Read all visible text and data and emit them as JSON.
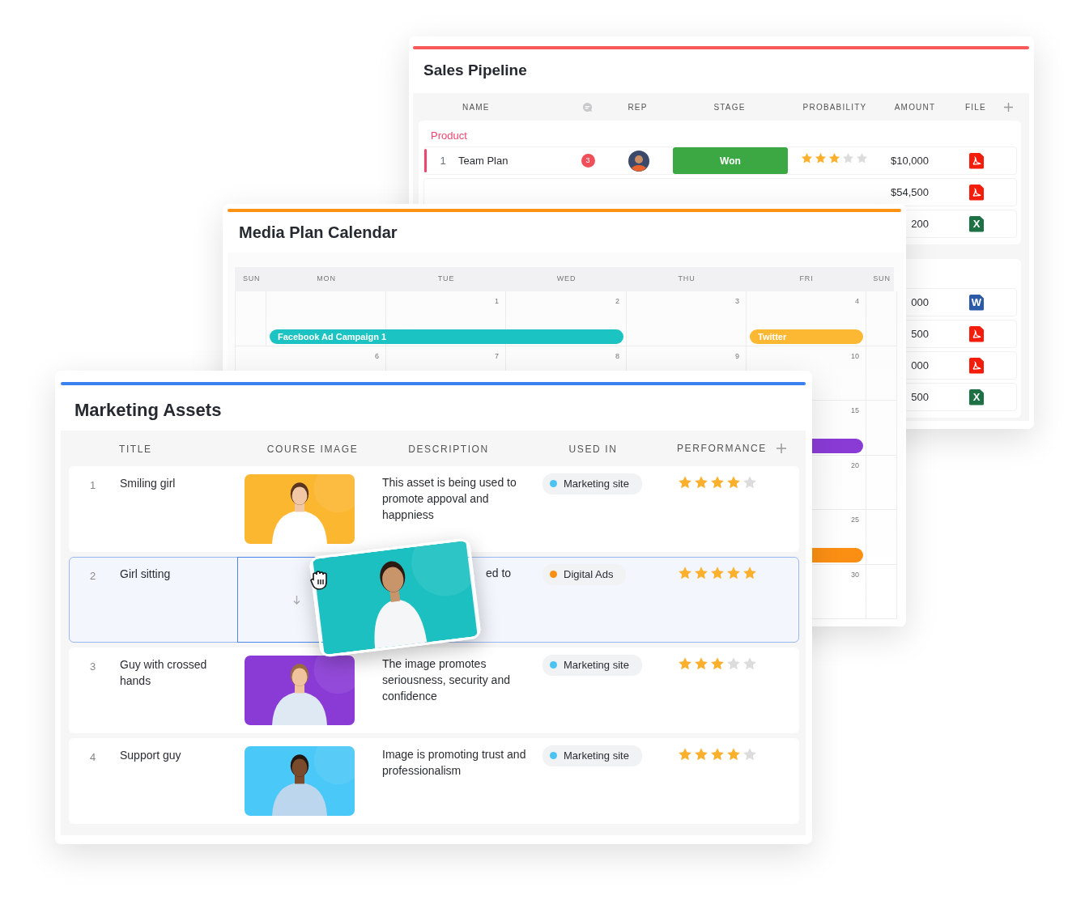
{
  "sales_pipeline": {
    "title": "Sales Pipeline",
    "columns": [
      {
        "kind": "text",
        "label": "NAME"
      },
      {
        "kind": "comments"
      },
      {
        "kind": "text",
        "label": "REP"
      },
      {
        "kind": "text",
        "label": "STAGE"
      },
      {
        "kind": "text",
        "label": "PROBABILITY"
      },
      {
        "kind": "text",
        "label": "AMOUNT"
      },
      {
        "kind": "text",
        "label": "FILE"
      },
      {
        "kind": "add"
      }
    ],
    "groups": [
      {
        "name": "Product",
        "rows": [
          {
            "number": "1",
            "name": "Team Plan",
            "comments": "3",
            "avatar": true,
            "stage": "Won",
            "stars": 3,
            "amount": "$10,000",
            "file": {
              "kind": "pdf"
            }
          },
          {
            "amount": "$54,500",
            "file": {
              "kind": "pdf"
            }
          },
          {
            "amount": "200",
            "file": {
              "kind": "excel",
              "letter": "X"
            }
          }
        ]
      },
      {
        "rows": [
          {
            "amount": "000",
            "file": {
              "kind": "word",
              "letter": "W"
            }
          },
          {
            "amount": "500",
            "file": {
              "kind": "pdf"
            }
          },
          {
            "amount": "000",
            "file": {
              "kind": "pdf"
            }
          },
          {
            "amount": "500",
            "file": {
              "kind": "excel",
              "letter": "X"
            }
          }
        ]
      }
    ]
  },
  "media_plan_calendar": {
    "title": "Media Plan Calendar",
    "days": [
      "SUN",
      "MON",
      "TUE",
      "WED",
      "THU",
      "FRI",
      "SUN"
    ],
    "weeks": [
      {
        "cells": [
          {},
          {
            "event": {
              "title": "Facebook Ad Campaign 1",
              "color": "#1bc3c3"
            }
          },
          {
            "date": "1",
            "event_continues": true
          },
          {
            "date": "2",
            "event_continues": true
          },
          {
            "date": "3"
          },
          {
            "date": "4",
            "event": {
              "title": "Twitter",
              "color": "#fdb833"
            }
          },
          {}
        ]
      },
      {
        "cells": [
          {},
          {
            "date": "6"
          },
          {
            "date": "7"
          },
          {
            "date": "8"
          },
          {
            "date": "9"
          },
          {
            "date": "10"
          },
          {}
        ]
      },
      {
        "cells": [
          {},
          {},
          {},
          {},
          {},
          {
            "date": "15",
            "event": {
              "color": "#8a3bd6",
              "continued": true
            }
          },
          {}
        ]
      },
      {
        "cells": [
          {},
          {},
          {},
          {},
          {},
          {
            "date": "20"
          },
          {}
        ]
      },
      {
        "cells": [
          {},
          {},
          {},
          {},
          {},
          {
            "date": "25",
            "event": {
              "color": "#fb8f14",
              "continued": true
            }
          },
          {}
        ]
      },
      {
        "cells": [
          {},
          {},
          {},
          {},
          {},
          {
            "date": "30"
          },
          {}
        ]
      }
    ]
  },
  "marketing_assets": {
    "title": "Marketing Assets",
    "columns": [
      "TITLE",
      "COURSE IMAGE",
      "DESCRIPTION",
      "USED IN",
      "PERFORMANCE"
    ],
    "rows": [
      {
        "number": "1",
        "title": "Smiling girl",
        "image": {
          "kind": "picture"
        },
        "description": "This asset is being used to promote appoval and happniess",
        "used_in": {
          "label": "Marketing site",
          "color": "#4cc3f5"
        },
        "stars": 4,
        "selected": false
      },
      {
        "number": "2",
        "title": "Girl sitting",
        "image": {
          "kind": "drop-target"
        },
        "description": "ed to",
        "used_in": {
          "label": "Digital Ads",
          "color": "#fb8f14"
        },
        "stars": 5,
        "selected": true
      },
      {
        "number": "3",
        "title": "Guy with crossed hands",
        "image": {
          "kind": "picture"
        },
        "description": "The image promotes seriousness, security and confidence",
        "used_in": {
          "label": "Marketing site",
          "color": "#4cc3f5"
        },
        "stars": 3,
        "selected": false
      },
      {
        "number": "4",
        "title": "Support guy",
        "image": {
          "kind": "picture"
        },
        "description": "Image is promoting trust and professionalism",
        "used_in": {
          "label": "Marketing site",
          "color": "#4cc3f5"
        },
        "stars": 4,
        "selected": false
      }
    ],
    "dragged_item": {
      "kind": "picture"
    }
  }
}
